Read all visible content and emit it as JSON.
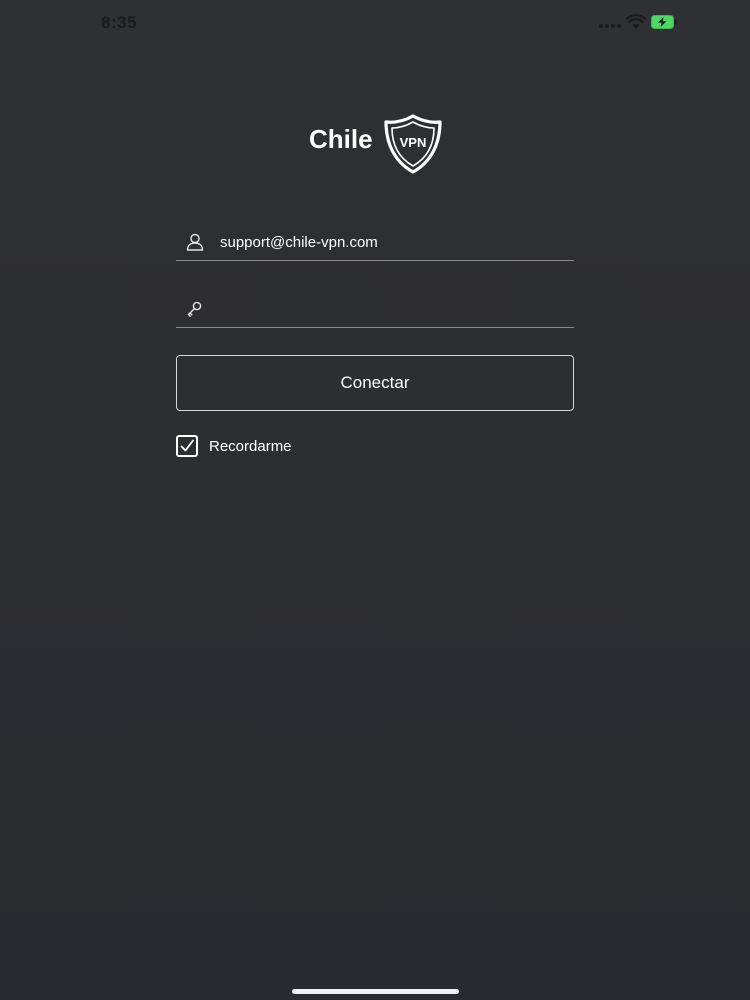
{
  "status_bar": {
    "time": "8:35",
    "battery_color": "#4cd964"
  },
  "logo": {
    "brand_word": "Chile",
    "badge_text": "VPN"
  },
  "login_form": {
    "email_value": "support@chile-vpn.com",
    "email_icon": "user-icon",
    "password_value": "",
    "password_icon": "key-icon",
    "connect_label": "Conectar",
    "remember_label": "Recordarme",
    "remember_checked": true
  }
}
